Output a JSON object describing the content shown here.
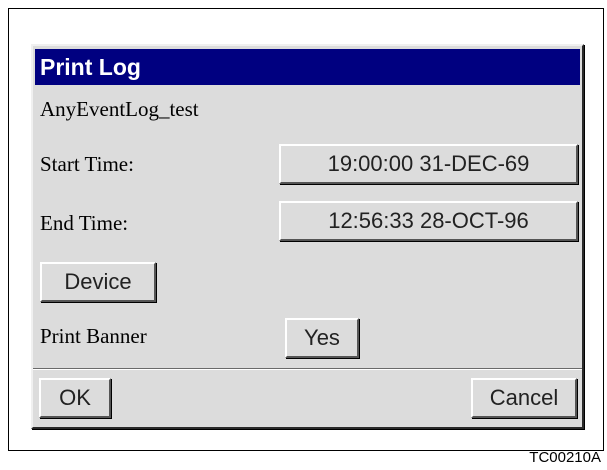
{
  "dialog": {
    "title": "Print Log",
    "log_name": "AnyEventLog_test",
    "start_time_label": "Start Time:",
    "start_time_value": "19:00:00  31-DEC-69",
    "end_time_label": "End Time:",
    "end_time_value": "12:56:33  28-OCT-96",
    "device_button": "Device",
    "print_banner_label": "Print Banner",
    "print_banner_value": "Yes",
    "ok_button": "OK",
    "cancel_button": "Cancel"
  },
  "figure": {
    "caption": "TC00210A"
  },
  "colors": {
    "titlebar": "#000080",
    "dialog_bg": "#dcdcdc"
  }
}
